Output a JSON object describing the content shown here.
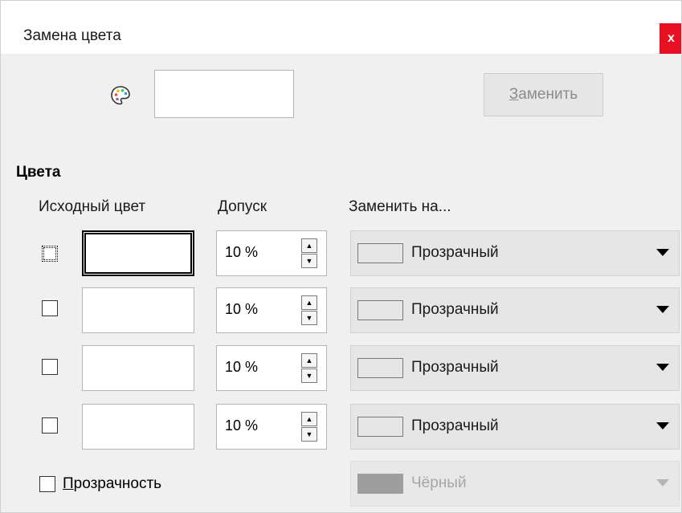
{
  "window": {
    "title": "Замена цвета",
    "close_label": "x"
  },
  "top": {
    "palette_icon": "palette-icon",
    "replace_button": {
      "accel": "З",
      "rest": "аменить"
    }
  },
  "colors_section": {
    "label": "Цвета",
    "headers": {
      "source": "Исходный цвет",
      "tolerance": "Допуск",
      "replace_with": "Заменить на..."
    },
    "rows": [
      {
        "checked": false,
        "tolerance": "10 %",
        "replace_with": "Прозрачный"
      },
      {
        "checked": false,
        "tolerance": "10 %",
        "replace_with": "Прозрачный"
      },
      {
        "checked": false,
        "tolerance": "10 %",
        "replace_with": "Прозрачный"
      },
      {
        "checked": false,
        "tolerance": "10 %",
        "replace_with": "Прозрачный"
      }
    ]
  },
  "transparency": {
    "checked": false,
    "label_accel": "П",
    "label_rest": "розрачность",
    "color": "Чёрный"
  },
  "colors": {
    "close_bg": "#e81123",
    "disabled_text": "#8c8c8c",
    "black_swatch": "#9e9e9e"
  }
}
